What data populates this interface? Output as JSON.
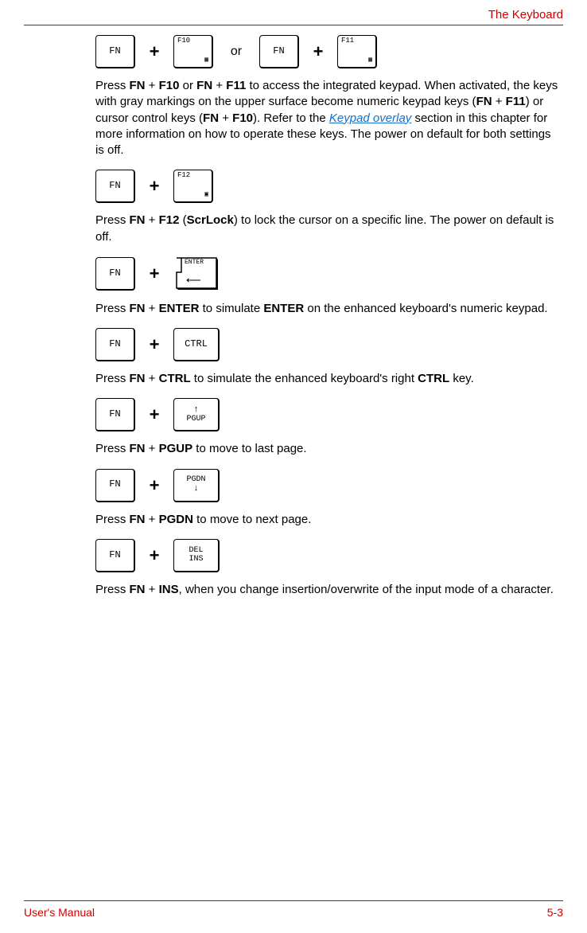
{
  "header": {
    "title": "The Keyboard"
  },
  "row1": {
    "k1": "FN",
    "k2_top": "F10",
    "or": "or",
    "k3": "FN",
    "k4_top": "F11"
  },
  "p1": {
    "t1": "Press ",
    "b1": "FN",
    "t2": " + ",
    "b2": "F10",
    "t3": " or ",
    "b3": "FN",
    "t4": " + ",
    "b4": "F11",
    "t5": " to access the integrated keypad. When activated, the keys with gray markings on the upper surface become numeric keypad keys (",
    "b5": "FN",
    "t6": " + ",
    "b6": "F11",
    "t7": ") or cursor control keys (",
    "b7": "FN",
    "t8": " + ",
    "b8": "F10",
    "t9": "). Refer to the ",
    "link": "Keypad overlay",
    "t10": " section in this chapter for more information on how to operate these keys. The power on default for both settings is off."
  },
  "row2": {
    "k1": "FN",
    "k2_top": "F12"
  },
  "p2": {
    "t1": "Press ",
    "b1": "FN",
    "t2": " + ",
    "b2": "F12",
    "t3": " (",
    "b3": "ScrLock",
    "t4": ") to lock the cursor on a specific line. The power on default is off."
  },
  "row3": {
    "k1": "FN",
    "k2_label": "ENTER"
  },
  "p3": {
    "t1": "Press ",
    "b1": "FN",
    "t2": " + ",
    "b2": "ENTER",
    "t3": " to simulate ",
    "b3": "ENTER",
    "t4": " on the enhanced keyboard's numeric keypad."
  },
  "row4": {
    "k1": "FN",
    "k2": "CTRL"
  },
  "p4": {
    "t1": "Press ",
    "b1": "FN",
    "t2": " + ",
    "b2": "CTRL",
    "t3": " to simulate the enhanced keyboard's right ",
    "b3": "CTRL",
    "t4": " key."
  },
  "row5": {
    "k1": "FN",
    "k2_top": "↑",
    "k2_bot": "PGUP"
  },
  "p5": {
    "t1": "Press ",
    "b1": "FN",
    "t2": " + ",
    "b2": "PGUP",
    "t3": " to move to last page."
  },
  "row6": {
    "k1": "FN",
    "k2_top": "PGDN",
    "k2_bot": "↓"
  },
  "p6": {
    "t1": "Press ",
    "b1": "FN",
    "t2": " + ",
    "b2": "PGDN",
    "t3": " to move to next page."
  },
  "row7": {
    "k1": "FN",
    "k2_top": "DEL",
    "k2_bot": "INS"
  },
  "p7": {
    "t1": "Press ",
    "b1": "FN",
    "t2": " + ",
    "b2": "INS",
    "t3": ", when you change insertion/overwrite of the input mode of a character."
  },
  "footer": {
    "left": "User's Manual",
    "right": "5-3"
  }
}
